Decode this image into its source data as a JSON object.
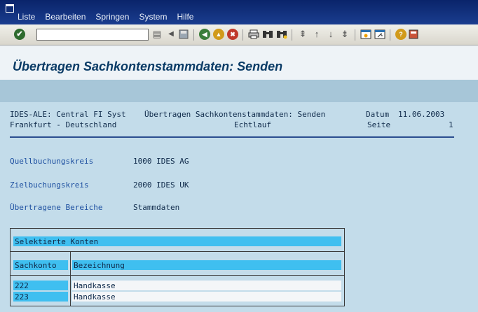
{
  "menubar": {
    "items": [
      {
        "label": "Liste"
      },
      {
        "label": "Bearbeiten"
      },
      {
        "label": "Springen"
      },
      {
        "label": "System"
      },
      {
        "label": "Hilfe"
      }
    ]
  },
  "toolbar": {
    "command_field_value": "",
    "icons": [
      "enter-icon",
      "save-icon",
      "back-icon",
      "exit-icon",
      "cancel-icon",
      "print-icon",
      "find-icon",
      "find-next-icon",
      "first-page-icon",
      "previous-page-icon",
      "next-page-icon",
      "last-page-icon",
      "create-session-icon",
      "shortcut-icon",
      "help-icon",
      "layout-icon"
    ]
  },
  "title": "Übertragen Sachkontenstammdaten: Senden",
  "report": {
    "header_line1": {
      "system": "IDES-ALE: Central FI Syst",
      "title": "Übertragen Sachkontenstammdaten: Senden",
      "date_label": "Datum",
      "date_value": "11.06.2003"
    },
    "header_line2": {
      "location": "Frankfurt - Deutschland",
      "mode": "Echtlauf",
      "page_label": "Seite",
      "page_value": "1"
    },
    "fields": [
      {
        "label": "Quellbuchungskreis",
        "value": "1000 IDES AG"
      },
      {
        "label": "Zielbuchungskreis",
        "value": "2000 IDES UK"
      },
      {
        "label": "Übertragene Bereiche",
        "value": "Stammdaten"
      }
    ],
    "table": {
      "title": "Selektierte Konten",
      "columns": [
        "Sachkonto",
        "Bezeichnung"
      ],
      "rows": [
        {
          "account": "222",
          "description": "Handkasse"
        },
        {
          "account": "223",
          "description": "Handkasse"
        }
      ]
    }
  },
  "colors": {
    "menubar": "#0a246a",
    "background": "#c3dcea",
    "title_text": "#0a3b66",
    "highlight_band": "#3fbff0"
  }
}
